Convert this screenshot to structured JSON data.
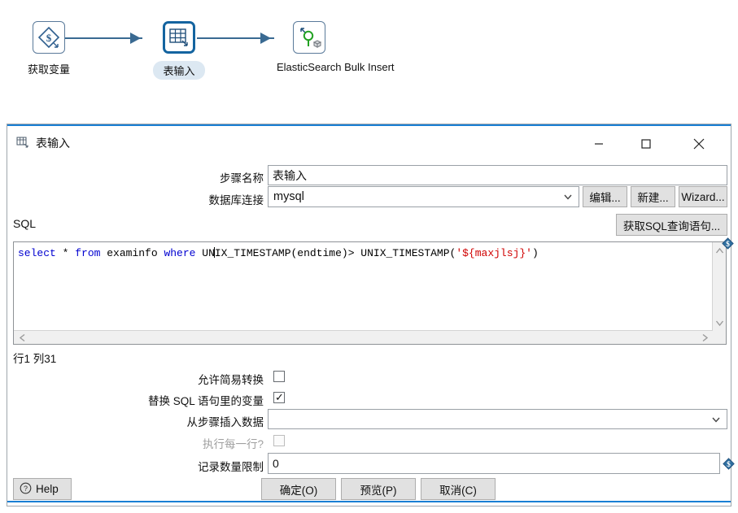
{
  "canvas": {
    "nodes": [
      {
        "label": "获取变量",
        "icon": "get-variable-icon",
        "selected": false
      },
      {
        "label": "表输入",
        "icon": "table-input-icon",
        "selected": true
      },
      {
        "label": "ElasticSearch Bulk Insert",
        "icon": "elasticsearch-bulk-insert-icon",
        "selected": false
      }
    ]
  },
  "dialog": {
    "title": "表输入",
    "title_icon": "table-input-icon",
    "window_controls": {
      "minimize": "minimize-icon",
      "maximize": "maximize-icon",
      "close": "close-icon"
    },
    "fields": {
      "step_name_label": "步骤名称",
      "step_name_value": "表输入",
      "connection_label": "数据库连接",
      "connection_value": "mysql",
      "connection_edit_button": "编辑...",
      "connection_new_button": "新建...",
      "connection_wizard_button": "Wizard..."
    },
    "sql": {
      "label": "SQL",
      "get_sql_button": "获取SQL查询语句...",
      "text": "select * from examinfo where UNIX_TIMESTAMP(endtime)> UNIX_TIMESTAMP('${maxjlsj}')",
      "tokens": [
        {
          "t": "select",
          "k": "kw"
        },
        {
          "t": " * ",
          "k": "pln"
        },
        {
          "t": "from",
          "k": "kw"
        },
        {
          "t": " examinfo ",
          "k": "pln"
        },
        {
          "t": "where",
          "k": "kw"
        },
        {
          "t": " UN",
          "k": "pln"
        },
        {
          "t": "|CARET|",
          "k": "caret"
        },
        {
          "t": "IX_TIMESTAMP(endtime)> UNIX_TIMESTAMP(",
          "k": "pln"
        },
        {
          "t": "'${maxjlsj}'",
          "k": "str"
        },
        {
          "t": ")",
          "k": "pln"
        }
      ],
      "position_text": "行1 列31",
      "variable_icon": "variable-diamond-icon"
    },
    "options": {
      "simple_convert_label": "允许简易转换",
      "simple_convert_checked": false,
      "replace_vars_label": "替换 SQL 语句里的变量",
      "replace_vars_checked": true,
      "insert_from_step_label": "从步骤插入数据",
      "insert_from_step_value": "",
      "execute_each_row_label": "执行每一行?",
      "execute_each_row_checked": false,
      "execute_each_row_disabled": true,
      "limit_label": "记录数量限制",
      "limit_value": "0",
      "limit_variable_icon": "variable-diamond-icon"
    },
    "buttons": {
      "help": "Help",
      "help_icon": "help-icon",
      "ok": "确定(O)",
      "preview": "预览(P)",
      "cancel": "取消(C)"
    }
  },
  "colors": {
    "accent": "#1a7fd4",
    "node_border": "#5a7a9a",
    "node_selected": "#1464a0",
    "keyword": "#0000d0",
    "string": "#d00000",
    "button_face": "#e1e1e1"
  }
}
